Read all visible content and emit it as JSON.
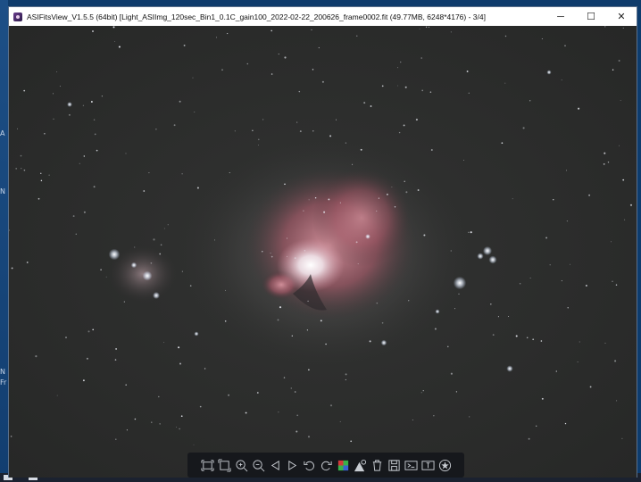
{
  "window": {
    "title": "ASIFitsView_V1.5.5 (64bit) [Light_ASIImg_120sec_Bin1_0.1C_gain100_2022-02-22_200626_frame0002.fit (49.77MB, 6248*4176) - 3/4]",
    "app_icon": "asifitsview-app-icon",
    "minimize_glyph": "─",
    "maximize_glyph": "☐",
    "close_glyph": "✕"
  },
  "desktop": {
    "left_chars": [
      "A",
      "N",
      "N",
      "Fr"
    ]
  },
  "toolbar": {
    "buttons": [
      {
        "name": "fit-to-window-icon"
      },
      {
        "name": "actual-size-icon"
      },
      {
        "name": "zoom-in-icon"
      },
      {
        "name": "zoom-out-icon"
      },
      {
        "name": "previous-image-icon"
      },
      {
        "name": "next-image-icon"
      },
      {
        "name": "rotate-left-icon"
      },
      {
        "name": "rotate-right-icon"
      },
      {
        "name": "debayer-icon"
      },
      {
        "name": "stretch-icon"
      },
      {
        "name": "delete-icon"
      },
      {
        "name": "save-icon"
      },
      {
        "name": "histogram-icon"
      },
      {
        "name": "info-icon"
      },
      {
        "name": "annotate-icon"
      }
    ]
  },
  "colors": {
    "sky": "#2c2d2c",
    "nebula": "#b06a76",
    "core": "#f4eef2",
    "toolbar_bg": "#16181c",
    "icon": "#c8ccd2"
  }
}
